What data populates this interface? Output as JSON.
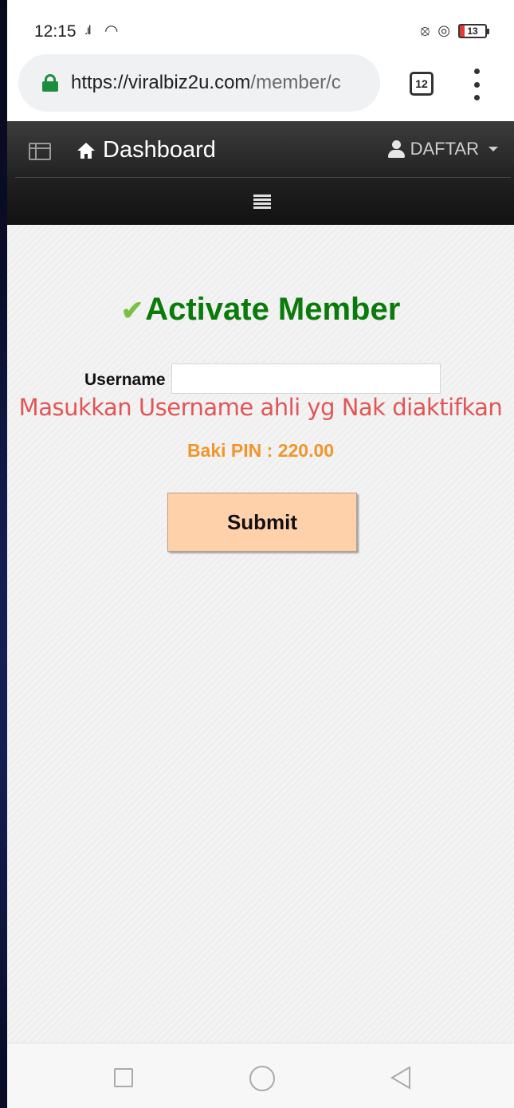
{
  "status_bar": {
    "time": "12:15",
    "battery": "13"
  },
  "browser": {
    "url_domain": "https://viralbiz2u.com",
    "url_path": "/member/c",
    "tab_count": "12"
  },
  "navbar": {
    "brand": "Dashboard",
    "user_menu": "DAFTAR"
  },
  "form": {
    "title": "Activate Member",
    "username_label": "Username",
    "username_value": "",
    "hint": "Masukkan Username ahli yg Nak diaktifkan",
    "pin_balance": "Baki PIN : 220.00",
    "submit_label": "Submit"
  },
  "colors": {
    "title_green": "#0a7a0a",
    "hint_red": "#e25555",
    "pin_orange": "#f0952c",
    "button_peach": "#ffd1aa"
  },
  "icons": [
    "lock-icon",
    "sidebar-toggle-icon",
    "home-icon",
    "user-icon",
    "caret-icon",
    "hamburger-icon",
    "check-icon"
  ]
}
